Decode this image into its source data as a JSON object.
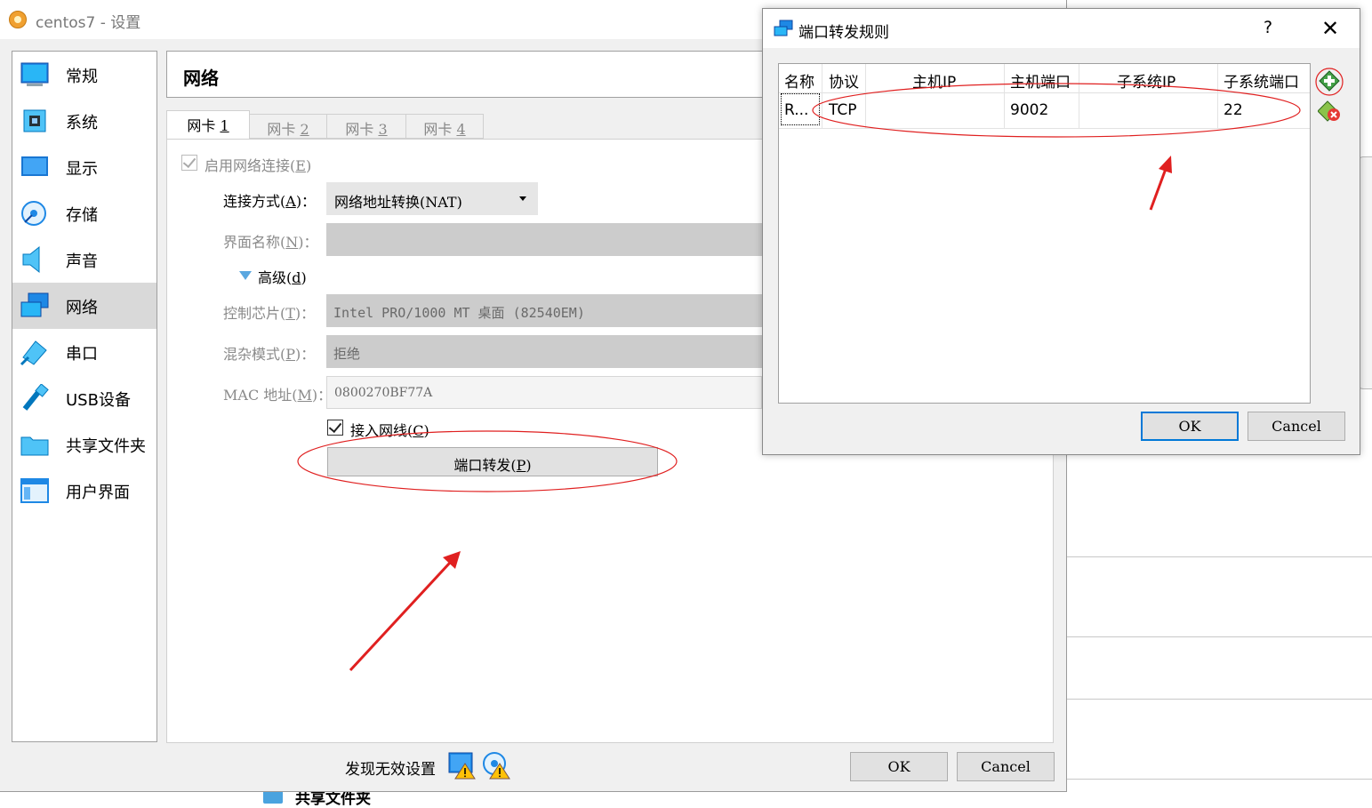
{
  "background_app": {
    "bottom_item_label": "共享文件夹"
  },
  "settings_window": {
    "title": "centos7 - 设置",
    "sidebar": [
      {
        "label": "常规",
        "icon": "general-icon"
      },
      {
        "label": "系统",
        "icon": "system-icon"
      },
      {
        "label": "显示",
        "icon": "display-icon"
      },
      {
        "label": "存储",
        "icon": "storage-icon"
      },
      {
        "label": "声音",
        "icon": "audio-icon"
      },
      {
        "label": "网络",
        "icon": "network-icon",
        "selected": true
      },
      {
        "label": "串口",
        "icon": "serial-port-icon"
      },
      {
        "label": "USB设备",
        "icon": "usb-icon"
      },
      {
        "label": "共享文件夹",
        "icon": "shared-folder-icon"
      },
      {
        "label": "用户界面",
        "icon": "user-interface-icon"
      }
    ],
    "page_title": "网络",
    "tabs": [
      {
        "label": "网卡 ",
        "num": "1",
        "active": true
      },
      {
        "label": "网卡 ",
        "num": "2"
      },
      {
        "label": "网卡 ",
        "num": "3"
      },
      {
        "label": "网卡 ",
        "num": "4"
      }
    ],
    "enable_network": {
      "label": "启用网络连接(",
      "key": "E",
      "close": ")",
      "checked": true
    },
    "attached_to": {
      "label": "连接方式(",
      "key": "A",
      "close": ")：",
      "value": "网络地址转换(NAT)"
    },
    "interface_name": {
      "label": "界面名称(",
      "key": "N",
      "close": ")：",
      "value": ""
    },
    "advanced": {
      "label": "高级(",
      "key": "d",
      "close": ")"
    },
    "adapter_type": {
      "label": "控制芯片(",
      "key": "T",
      "close": ")：",
      "value": "Intel PRO/1000 MT 桌面 (82540EM)"
    },
    "promiscuous": {
      "label": "混杂模式(",
      "key": "P",
      "close": ")：",
      "value": "拒绝"
    },
    "mac": {
      "label": "MAC 地址(",
      "key": "M",
      "close": ")：",
      "value": "0800270BF77A"
    },
    "cable_connected": {
      "label": "接入网线(",
      "key": "C",
      "close": ")",
      "checked": true
    },
    "port_forward_button": {
      "label": "端口转发(",
      "key": "P",
      "close": ")"
    },
    "status_text": "发现无效设置",
    "ok": "OK",
    "cancel": "Cancel"
  },
  "port_dialog": {
    "title": "端口转发规则",
    "help": "?",
    "close": "✕",
    "columns": [
      "名称",
      "协议",
      "主机IP",
      "主机端口",
      "子系统IP",
      "子系统端口"
    ],
    "rows": [
      {
        "name": "R...",
        "protocol": "TCP",
        "host_ip": "",
        "host_port": "9002",
        "guest_ip": "",
        "guest_port": "22"
      }
    ],
    "add_rule_icon": "add-rule-icon",
    "remove_rule_icon": "remove-rule-icon",
    "ok": "OK",
    "cancel": "Cancel"
  },
  "colors": {
    "annotation_red": "#e02020",
    "accent_blue": "#0078d7",
    "selected_sidebar": "#d9d9d9"
  }
}
